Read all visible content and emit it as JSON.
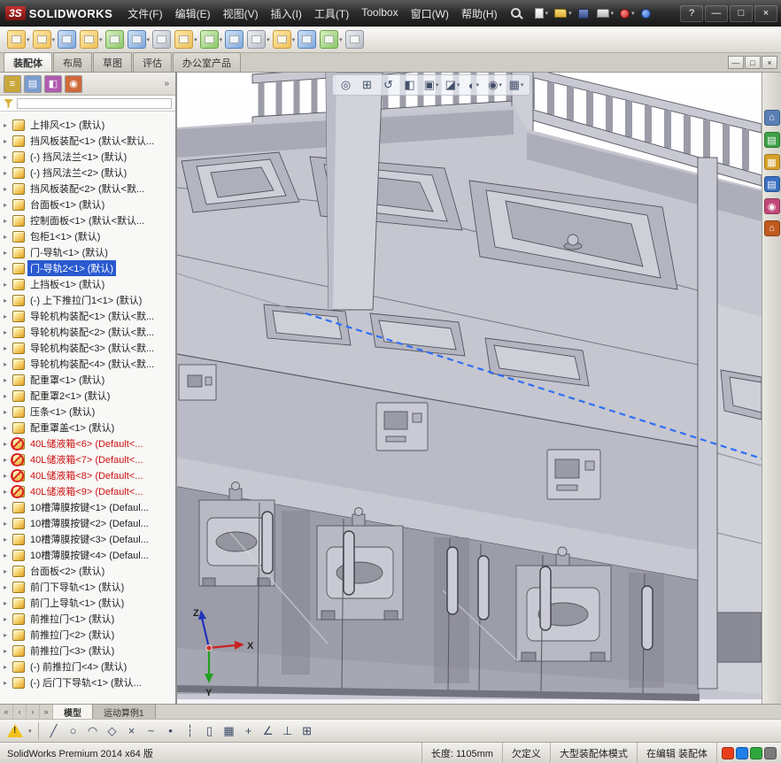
{
  "titlebar": {
    "logo_mark": "3S",
    "logo_text": "SOLIDWORKS",
    "menus": [
      "文件(F)",
      "编辑(E)",
      "视图(V)",
      "插入(I)",
      "工具(T)",
      "Toolbox",
      "窗口(W)",
      "帮助(H)"
    ],
    "quick_icons": [
      {
        "name": "new-document",
        "kind": "sheet",
        "drop": "▾"
      },
      {
        "name": "open-document",
        "kind": "folder",
        "drop": "▾"
      },
      {
        "name": "save-document",
        "kind": "save"
      },
      {
        "name": "print-document",
        "kind": "print",
        "drop": "▾"
      },
      {
        "name": "options",
        "kind": "opt",
        "drop": "▾"
      },
      {
        "name": "file-properties",
        "kind": "info"
      }
    ],
    "window_controls": [
      {
        "name": "help-button",
        "glyph": "?"
      },
      {
        "name": "minimize-button",
        "glyph": "—"
      },
      {
        "name": "maximize-button",
        "glyph": "□"
      },
      {
        "name": "close-button",
        "glyph": "×"
      }
    ]
  },
  "toolbar": {
    "icons": [
      {
        "name": "edit-component",
        "tone": "tone-yellow",
        "drop": "▾"
      },
      {
        "name": "insert-components",
        "tone": "tone-yellow",
        "drop": "▾"
      },
      {
        "name": "mate",
        "tone": "tone-blue"
      },
      {
        "name": "linear-component-pattern",
        "tone": "tone-yellow",
        "drop": "▾"
      },
      {
        "name": "smart-fasteners",
        "tone": "tone-green"
      },
      {
        "name": "move-component",
        "tone": "tone-blue",
        "drop": "▾"
      },
      {
        "name": "show-hidden-components",
        "tone": "tone-gray"
      },
      {
        "name": "assembly-features",
        "tone": "tone-yellow",
        "drop": "▾"
      },
      {
        "name": "reference-geometry",
        "tone": "tone-green",
        "drop": "▾"
      },
      {
        "name": "new-motion-study",
        "tone": "tone-blue"
      },
      {
        "name": "bill-of-materials",
        "tone": "tone-gray",
        "drop": "▾"
      },
      {
        "name": "exploded-view",
        "tone": "tone-yellow",
        "drop": "▾"
      },
      {
        "name": "explode-line-sketch",
        "tone": "tone-blue"
      },
      {
        "name": "interference-detection",
        "tone": "tone-green",
        "drop": "▾"
      },
      {
        "name": "assembly-visualization",
        "tone": "tone-gray"
      }
    ]
  },
  "command_tabs": [
    {
      "label": "装配体",
      "state": "active"
    },
    {
      "label": "布局"
    },
    {
      "label": "草图"
    },
    {
      "label": "评估"
    },
    {
      "label": "办公室产品"
    }
  ],
  "feature_panel": {
    "expand_glyph": "▸",
    "overflow": "»",
    "tabs": [
      {
        "name": "feature-manager-tree-tab",
        "bg": "#caa73c",
        "glyph": "≡"
      },
      {
        "name": "property-manager-tab",
        "bg": "#7a9cd0",
        "glyph": "▤"
      },
      {
        "name": "configuration-manager-tab",
        "bg": "#b05ab0",
        "glyph": "◧"
      },
      {
        "name": "display-manager-tab",
        "bg": "#d06a3a",
        "glyph": "◉"
      }
    ],
    "items": [
      {
        "label": "上排风<1>",
        "config": "(默认)"
      },
      {
        "label": "挡风板装配<1>",
        "config": "(默认<默认..."
      },
      {
        "label": "(-) 挡风法兰<1>",
        "config": "(默认)"
      },
      {
        "label": "(-) 挡风法兰<2>",
        "config": "(默认)"
      },
      {
        "label": "挡风板装配<2>",
        "config": "(默认<默..."
      },
      {
        "label": "台面板<1>",
        "config": "(默认)"
      },
      {
        "label": "控制面板<1>",
        "config": "(默认<默认..."
      },
      {
        "label": "包柜1<1>",
        "config": "(默认)"
      },
      {
        "label": "门-导轨<1>",
        "config": "(默认)"
      },
      {
        "label": "门-导轨2<1>",
        "config": "(默认)",
        "state": "selected"
      },
      {
        "label": "上挡板<1>",
        "config": "(默认)"
      },
      {
        "label": "(-) 上下推拉门1<1>",
        "config": "(默认)"
      },
      {
        "label": "导轮机构装配<1>",
        "config": "(默认<默..."
      },
      {
        "label": "导轮机构装配<2>",
        "config": "(默认<默..."
      },
      {
        "label": "导轮机构装配<3>",
        "config": "(默认<默..."
      },
      {
        "label": "导轮机构装配<4>",
        "config": "(默认<默..."
      },
      {
        "label": "配重罩<1>",
        "config": "(默认)"
      },
      {
        "label": "配重罩2<1>",
        "config": "(默认)"
      },
      {
        "label": "压条<1>",
        "config": "(默认)"
      },
      {
        "label": "配重罩盖<1>",
        "config": "(默认)"
      },
      {
        "label": "40L储液箱<6>",
        "config": "(Default<...",
        "state": "error"
      },
      {
        "label": "40L储液箱<7>",
        "config": "(Default<...",
        "state": "error"
      },
      {
        "label": "40L储液箱<8>",
        "config": "(Default<...",
        "state": "error"
      },
      {
        "label": "40L储液箱<9>",
        "config": "(Default<...",
        "state": "error"
      },
      {
        "label": "10槽薄膜按键<1>",
        "config": "(Defaul..."
      },
      {
        "label": "10槽薄膜按键<2>",
        "config": "(Defaul..."
      },
      {
        "label": "10槽薄膜按键<3>",
        "config": "(Defaul..."
      },
      {
        "label": "10槽薄膜按键<4>",
        "config": "(Defaul..."
      },
      {
        "label": "台面板<2>",
        "config": "(默认)"
      },
      {
        "label": "前门下导轨<1>",
        "config": "(默认)"
      },
      {
        "label": "前门上导轨<1>",
        "config": "(默认)"
      },
      {
        "label": "前推拉门<1>",
        "config": "(默认)"
      },
      {
        "label": "前推拉门<2>",
        "config": "(默认)"
      },
      {
        "label": "前推拉门<3>",
        "config": "(默认)"
      },
      {
        "label": "(-) 前推拉门<4>",
        "config": "(默认)"
      },
      {
        "label": "(-) 后门下导轨<1>",
        "config": "(默认..."
      }
    ]
  },
  "viewport": {
    "heads_up": [
      {
        "name": "zoom-fit-icon",
        "glyph": "◎"
      },
      {
        "name": "zoom-area-icon",
        "glyph": "⊞"
      },
      {
        "name": "previous-view-icon",
        "glyph": "↺"
      },
      {
        "name": "section-view-icon",
        "glyph": "◧"
      },
      {
        "name": "view-orientation-icon",
        "glyph": "▣",
        "drop": "▾"
      },
      {
        "name": "display-style-icon",
        "glyph": "◪",
        "drop": "▾"
      },
      {
        "name": "hide-show-items-icon",
        "glyph": "◐",
        "drop": "▾"
      },
      {
        "name": "edit-appearance-icon",
        "glyph": "◉",
        "drop": "▾"
      },
      {
        "name": "apply-scene-icon",
        "glyph": "▦",
        "drop": "▾"
      }
    ],
    "child_window_controls": [
      {
        "name": "child-minimize-button",
        "glyph": "—"
      },
      {
        "name": "child-restore-button",
        "glyph": "□"
      },
      {
        "name": "child-close-button",
        "glyph": "×"
      }
    ],
    "triad": {
      "z": "Z",
      "x": "X",
      "y": "Y"
    },
    "selected_edge_color": "#2f6ff5"
  },
  "task_pane": {
    "icons": [
      {
        "name": "solidworks-resources-icon",
        "bg": "#5a7fb5",
        "glyph": "⌂"
      },
      {
        "name": "design-library-icon",
        "bg": "#3fa046",
        "glyph": "▤"
      },
      {
        "name": "file-explorer-icon",
        "bg": "#d8a02a",
        "glyph": "▦"
      },
      {
        "name": "view-palette-icon",
        "bg": "#3a6fc0",
        "glyph": "▤"
      },
      {
        "name": "appearances-icon",
        "bg": "#c04878",
        "glyph": "◉"
      },
      {
        "name": "custom-properties-icon",
        "bg": "#c05a1e",
        "glyph": "⌂"
      }
    ]
  },
  "bottom_tabs": {
    "nav": [
      "«",
      "‹",
      "›",
      "»"
    ],
    "tabs": [
      {
        "label": "模型",
        "state": "active"
      },
      {
        "label": "运动算例1"
      }
    ]
  },
  "sketch_bar": {
    "icons": [
      {
        "name": "sketch-line",
        "glyph": "╱"
      },
      {
        "name": "sketch-circle",
        "glyph": "○"
      },
      {
        "name": "sketch-arc",
        "glyph": "◠"
      },
      {
        "name": "sketch-polygon",
        "glyph": "◇"
      },
      {
        "name": "trim-entities",
        "glyph": "×"
      },
      {
        "name": "sketch-spline",
        "glyph": "~"
      },
      {
        "name": "sketch-point",
        "glyph": "•"
      },
      {
        "name": "centerline",
        "glyph": "┆"
      },
      {
        "name": "mirror-entities",
        "glyph": "▯"
      },
      {
        "name": "linear-sketch-pattern",
        "glyph": "▦"
      },
      {
        "name": "move-entities",
        "glyph": "+"
      },
      {
        "name": "quick-snaps",
        "glyph": "∠"
      },
      {
        "name": "display-relations",
        "glyph": "⊥"
      },
      {
        "name": "sketch-grid",
        "glyph": "⊞"
      }
    ]
  },
  "statusbar": {
    "left": "SolidWorks Premium 2014 x64 版",
    "items": [
      "长度: 1105mm",
      "欠定义",
      "大型装配体模式",
      "在编辑 装配体"
    ],
    "tray": [
      {
        "name": "tray-icon-1",
        "bg": "#e8401c"
      },
      {
        "name": "tray-icon-2",
        "bg": "#1f7fe8"
      },
      {
        "name": "tray-icon-3",
        "bg": "#30a83e"
      },
      {
        "name": "tray-icon-4",
        "bg": "#7a7a7a"
      }
    ]
  }
}
